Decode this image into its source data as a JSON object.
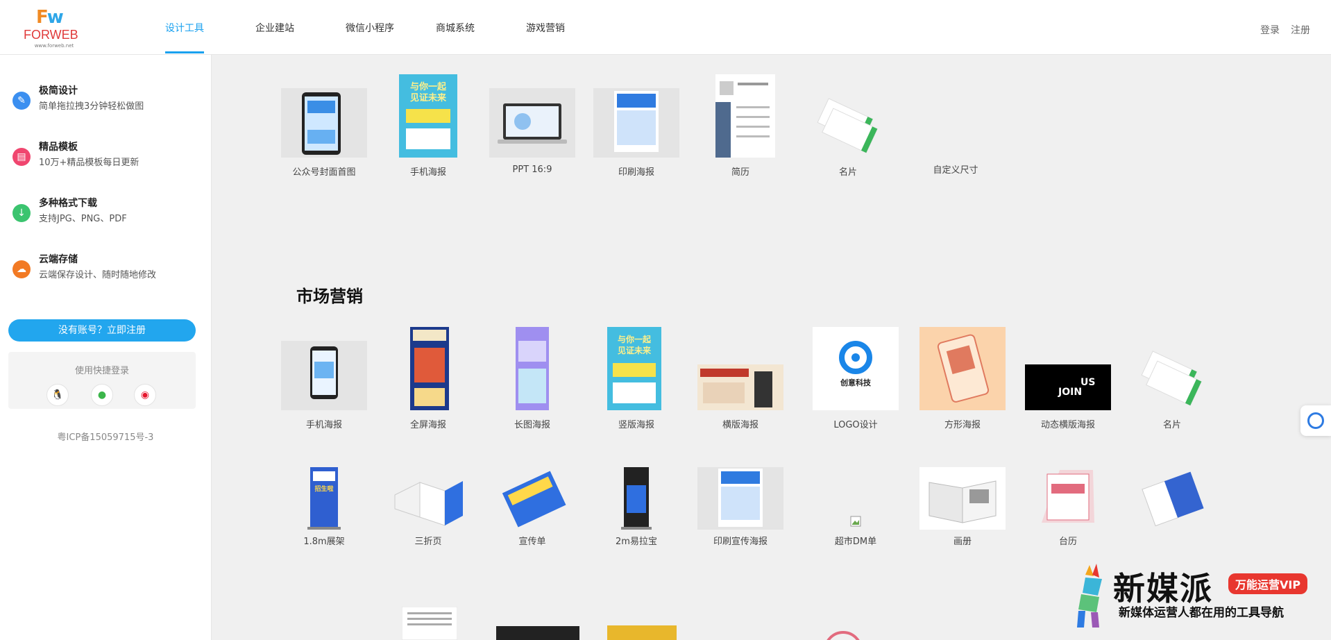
{
  "logo": {
    "mark": "Fw",
    "name": "FORWEB",
    "url": "www.forweb.net"
  },
  "nav": {
    "items": [
      "设计工具",
      "企业建站",
      "微信小程序",
      "商城系统",
      "游戏营销"
    ],
    "active_index": 0,
    "login": "登录",
    "register": "注册"
  },
  "sidebar": {
    "features": [
      {
        "title": "极简设计",
        "desc": "简单拖拉拽3分钟轻松做图",
        "icon": "pencil-icon",
        "color": "#3b8ff0"
      },
      {
        "title": "精品模板",
        "desc": "10万+精品模板每日更新",
        "icon": "template-icon",
        "color": "#f0466f"
      },
      {
        "title": "多种格式下载",
        "desc": "支持JPG、PNG、PDF",
        "icon": "download-icon",
        "color": "#3bc46f"
      },
      {
        "title": "云端存储",
        "desc": "云端保存设计、随时随地修改",
        "icon": "cloud-icon",
        "color": "#f27a24"
      }
    ],
    "register_button": "没有账号？立即注册",
    "quick_login_title": "使用快捷登录",
    "quick_login_icons": [
      "qq-icon",
      "wechat-icon",
      "weibo-icon"
    ],
    "icp": "粤ICP备15059715号-3"
  },
  "main": {
    "top_row": [
      "公众号封面首图",
      "手机海报",
      "PPT 16:9",
      "印刷海报",
      "简历",
      "名片",
      "自定义尺寸"
    ],
    "section_title": "市场营销",
    "marketing_row1": [
      "手机海报",
      "全屏海报",
      "长图海报",
      "竖版海报",
      "横版海报",
      "LOGO设计",
      "方形海报",
      "动态横版海报",
      "名片"
    ],
    "marketing_row2": [
      "1.8m展架",
      "三折页",
      "宣传单",
      "2m易拉宝",
      "印刷宣传海报",
      "超市DM单",
      "画册",
      "台历"
    ]
  },
  "thumb_text": {
    "poster_line1": "与你一起",
    "poster_line2": "见证未来",
    "logo_brand": "创意科技",
    "join": "JOIN",
    "us": "US",
    "rollup": "招生啦"
  },
  "watermark": {
    "main": "新媒派",
    "vip": "万能运营VIP",
    "sub": "新媒体运营人都在用的工具导航"
  },
  "colors": {
    "accent": "#1aa1ef",
    "register_button": "#22a6ee",
    "background": "#f0f0f0"
  }
}
